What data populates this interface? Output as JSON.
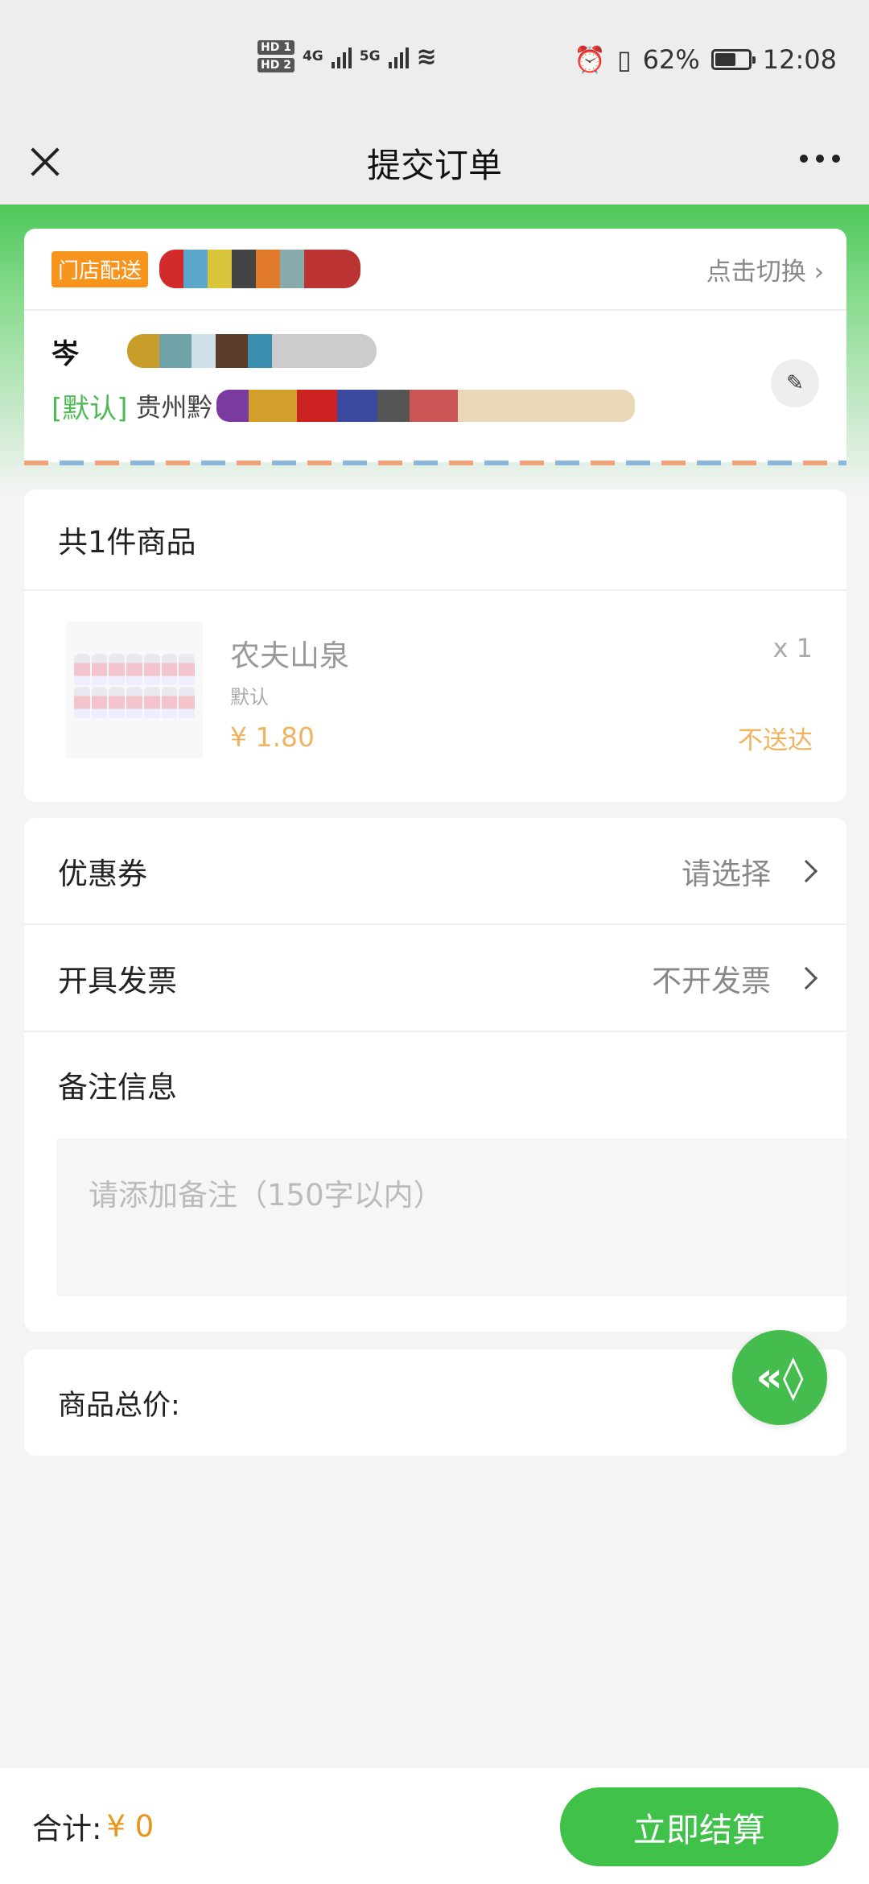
{
  "status_bar": {
    "hd1": "HD 1",
    "hd2": "HD 2",
    "net1": "4G",
    "net2": "5G",
    "battery_text": "62%",
    "battery_level": 0.62,
    "time": "12:08"
  },
  "navbar": {
    "title": "提交订单"
  },
  "address": {
    "delivery_tag": "门店配送",
    "switch_label": "点击切换 ›",
    "name": "岑",
    "default_tag": "[默认]",
    "address_prefix": "贵州黔"
  },
  "goods": {
    "header": "共1件商品",
    "items": [
      {
        "name": "农夫山泉",
        "spec": "默认",
        "price": "¥ 1.80",
        "qty": "x 1",
        "status": "不送达"
      }
    ]
  },
  "options": {
    "coupon_label": "优惠券",
    "coupon_value": "请选择",
    "invoice_label": "开具发票",
    "invoice_value": "不开发票",
    "remark_label": "备注信息",
    "remark_placeholder": "请添加备注（150字以内）"
  },
  "total": {
    "label": "商品总价:"
  },
  "footer": {
    "sum_label": "合计:",
    "sum_value": "¥ 0",
    "checkout_label": "立即结算"
  },
  "colors": {
    "brand_green": "#40c14a",
    "price_orange": "#f0b360",
    "store_tag": "#f7941d"
  }
}
